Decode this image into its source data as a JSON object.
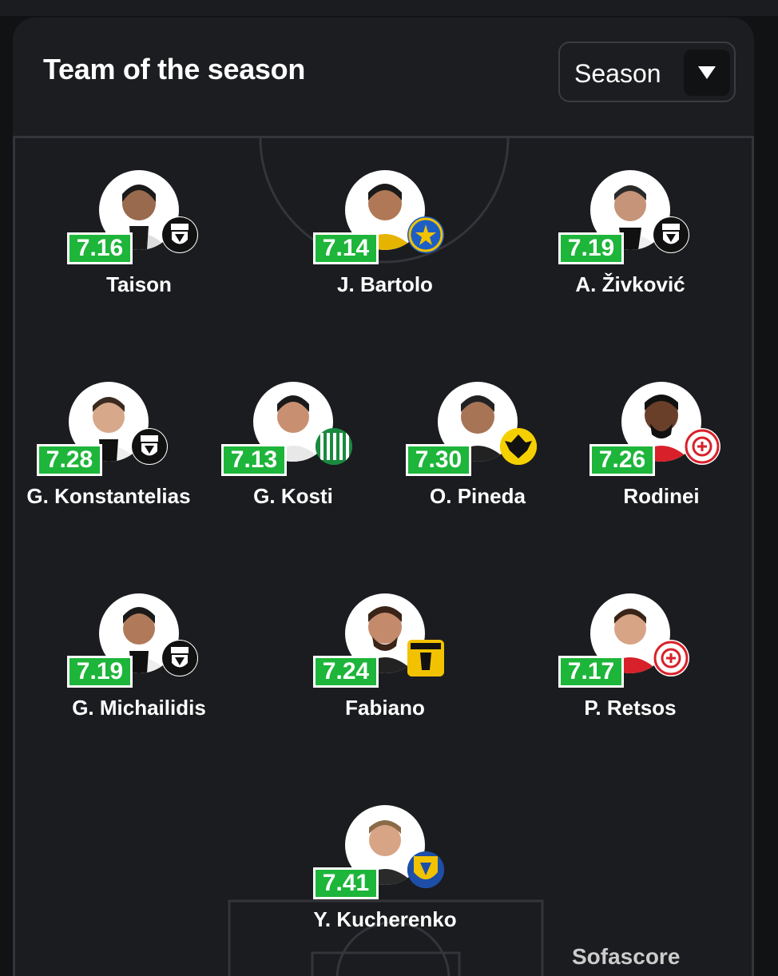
{
  "header": {
    "title": "Team of the season",
    "season_select": {
      "selected": "Season"
    }
  },
  "players": [
    {
      "name": "Taison",
      "rating": "7.16",
      "club": "PAOK"
    },
    {
      "name": "J. Bartolo",
      "rating": "7.14",
      "club": "Asteras Tripolis"
    },
    {
      "name": "A. Živković",
      "rating": "7.19",
      "club": "PAOK"
    },
    {
      "name": "G. Konstantelias",
      "rating": "7.28",
      "club": "PAOK"
    },
    {
      "name": "G. Kosti",
      "rating": "7.13",
      "club": "Levadiakos"
    },
    {
      "name": "O. Pineda",
      "rating": "7.30",
      "club": "AEK"
    },
    {
      "name": "Rodinei",
      "rating": "7.26",
      "club": "Olympiacos"
    },
    {
      "name": "G. Michailidis",
      "rating": "7.19",
      "club": "PAOK"
    },
    {
      "name": "Fabiano",
      "rating": "7.24",
      "club": "Aris"
    },
    {
      "name": "P. Retsos",
      "rating": "7.17",
      "club": "Olympiacos"
    },
    {
      "name": "Y. Kucherenko",
      "rating": "7.41",
      "club": "Panetolikos"
    }
  ],
  "branding": {
    "logo_text": "Sofascore"
  },
  "colors": {
    "rating_bg": "#1db53a",
    "card_bg": "#1c1d20",
    "pitch_line": "#33353a"
  }
}
